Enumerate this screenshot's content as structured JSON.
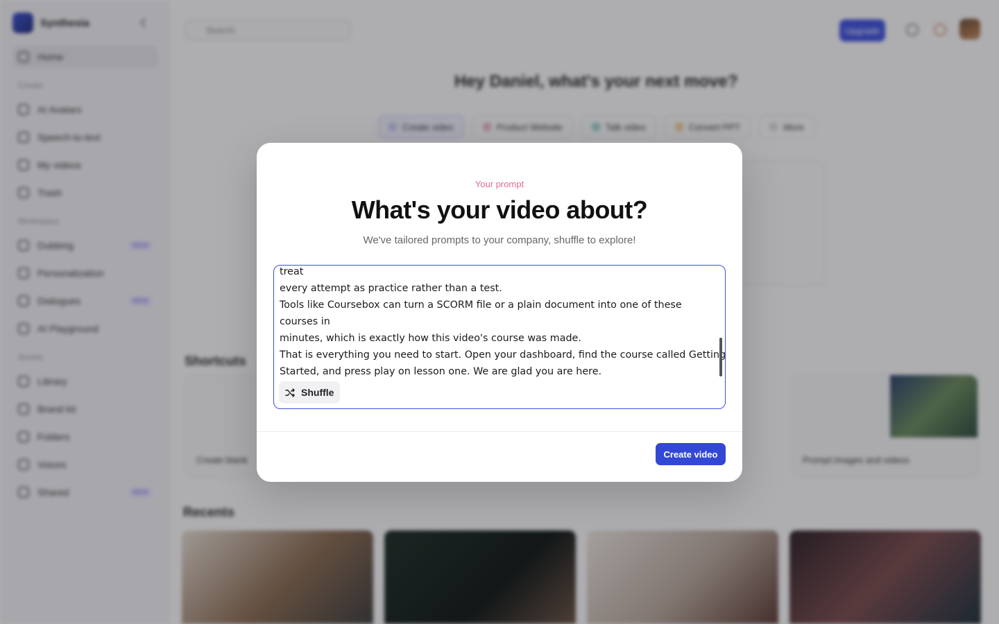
{
  "app": {
    "brand_name": "Synthesia",
    "sidebar": {
      "home": "Home",
      "section_create": "Create",
      "create_items": [
        "AI Avatars",
        "Speech-to-text",
        "My videos",
        "Trash"
      ],
      "section_workspace": "Workspace",
      "workspace_items": [
        {
          "label": "Dubbing",
          "badge": "NEW"
        },
        {
          "label": "Personalization",
          "badge": ""
        },
        {
          "label": "Dialogues",
          "badge": "NEW"
        },
        {
          "label": "AI Playground",
          "badge": ""
        }
      ],
      "section_assets": "Assets",
      "asset_items": [
        {
          "label": "Library",
          "badge": ""
        },
        {
          "label": "Brand kit",
          "badge": ""
        },
        {
          "label": "Folders",
          "badge": ""
        },
        {
          "label": "Voices",
          "badge": ""
        },
        {
          "label": "Shared",
          "badge": "NEW"
        }
      ]
    },
    "topbar": {
      "search_placeholder": "Search",
      "upgrade_label": "Upgrade"
    },
    "greeting": "Hey Daniel, what's your next move?",
    "chips": [
      "Create video",
      "Product Website",
      "Talk video",
      "Convert PPT",
      "More"
    ],
    "shortcuts_title": "Shortcuts",
    "shortcuts": [
      "Create blank",
      "Prompt images and videos"
    ],
    "recents_title": "Recents"
  },
  "modal": {
    "eyebrow": "Your prompt",
    "title": "What's your video about?",
    "subtitle": "We've tailored prompts to your company, shuffle to explore!",
    "prompt_lines": [
      "treat",
      "every attempt as practice rather than a test.",
      "Tools like Coursebox can turn a SCORM file or a plain document into one of these",
      "courses in",
      "minutes, which is exactly how this video's course was made.",
      "That is everything you need to start. Open your dashboard, find the course called Getting",
      "Started, and press play on lesson one. We are glad you are here."
    ],
    "shuffle_label": "Shuffle",
    "create_label": "Create video"
  },
  "colors": {
    "accent": "#3247d6",
    "eyebrow_gradient_start": "#f0735a",
    "eyebrow_gradient_end": "#d05bb8"
  }
}
